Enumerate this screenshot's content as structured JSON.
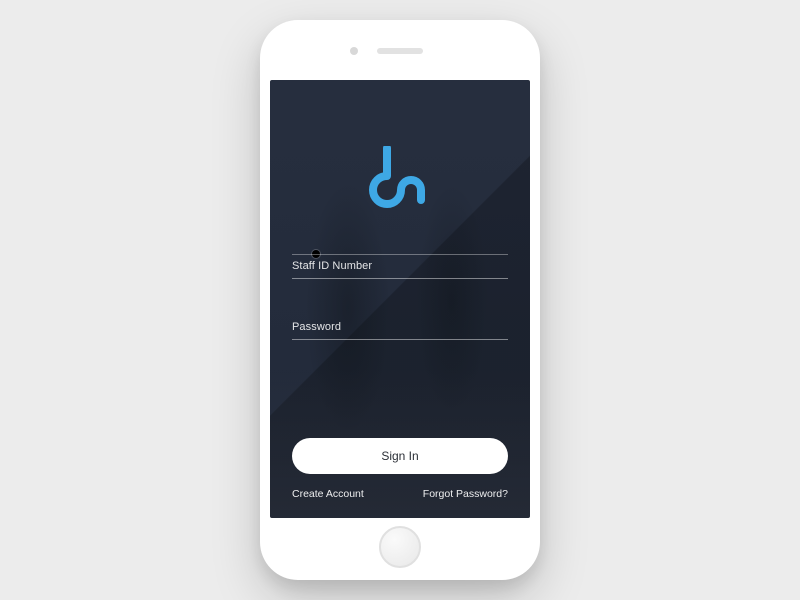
{
  "colors": {
    "accent": "#3ea8e5",
    "button_bg": "#ffffff",
    "button_text": "#2b2f36"
  },
  "logo": {
    "name": "dn-logo"
  },
  "form": {
    "staff_id": {
      "placeholder": "Staff ID Number",
      "value": ""
    },
    "password": {
      "placeholder": "Password",
      "value": ""
    },
    "signin_label": "Sign In"
  },
  "links": {
    "create_account": "Create Account",
    "forgot_password": "Forgot Password?"
  }
}
